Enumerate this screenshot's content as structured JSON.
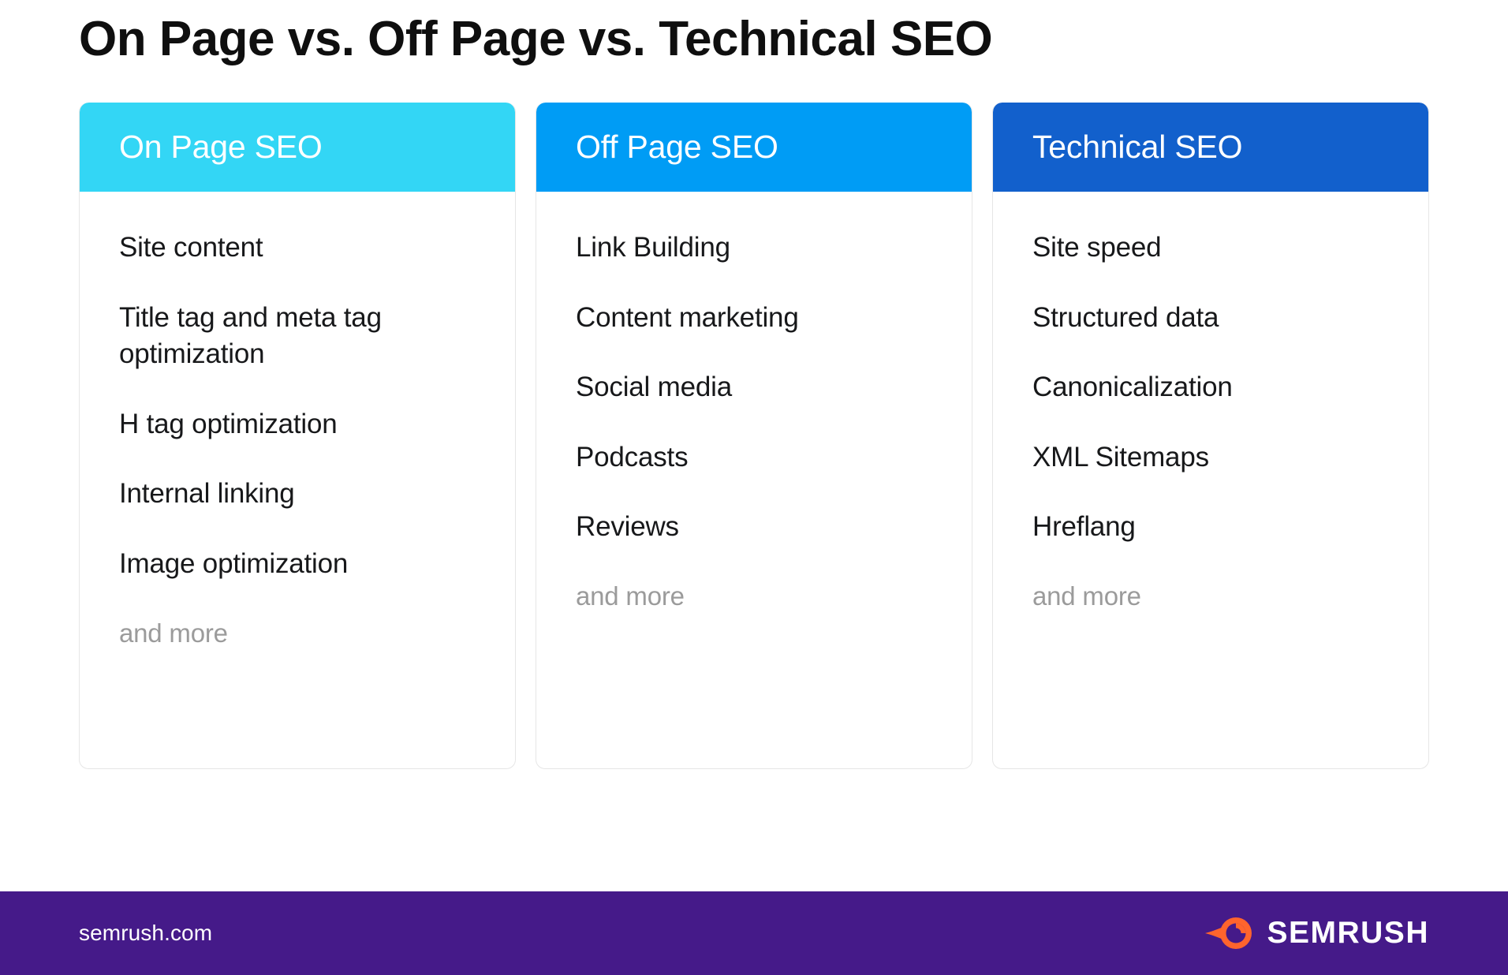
{
  "page": {
    "title": "On Page vs. Off Page vs. Technical SEO",
    "background_color": "#ffffff"
  },
  "columns": [
    {
      "header": "On Page SEO",
      "header_color": "#33D6F5",
      "items": [
        "Site content",
        "Title tag and meta tag optimization",
        "H tag optimization",
        "Internal linking",
        "Image optimization"
      ],
      "more_label": "and more"
    },
    {
      "header": "Off Page SEO",
      "header_color": "#009CF5",
      "items": [
        "Link Building",
        "Content marketing",
        "Social media",
        "Podcasts",
        "Reviews"
      ],
      "more_label": "and more"
    },
    {
      "header": "Technical SEO",
      "header_color": "#1260CC",
      "items": [
        "Site speed",
        "Structured data",
        "Canonicalization",
        "XML Sitemaps",
        "Hreflang"
      ],
      "more_label": "and more"
    }
  ],
  "footer": {
    "url": "semrush.com",
    "brand": "SEMRUSH",
    "background_color": "#451A89",
    "logo_icon": "semrush-comet-icon",
    "logo_color": "#FF642D"
  },
  "colors": {
    "text_primary": "#17181a",
    "text_muted": "#9b9b9b",
    "card_border": "#e6e6e6"
  }
}
